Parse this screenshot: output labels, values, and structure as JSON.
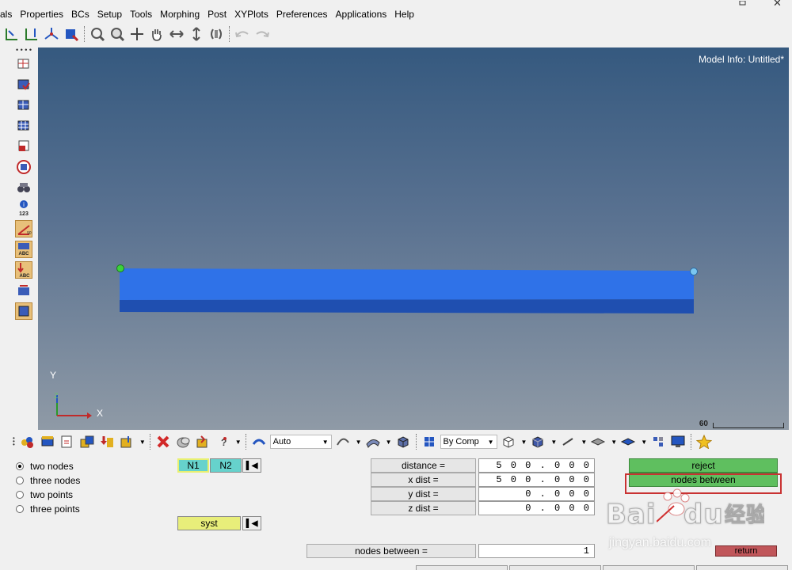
{
  "menu": [
    "als",
    "Properties",
    "BCs",
    "Setup",
    "Tools",
    "Morphing",
    "Post",
    "XYPlots",
    "Preferences",
    "Applications",
    "Help"
  ],
  "viewport": {
    "model_info": "Model Info: Untitled*",
    "axis_y": "Y",
    "axis_z": "Z",
    "axis_x": "X",
    "scale_label": "60"
  },
  "bottom_toolbar": {
    "auto_label": "Auto",
    "by_comp_label": "By Comp"
  },
  "panel": {
    "options": [
      {
        "label": "two nodes",
        "checked": true
      },
      {
        "label": "three nodes",
        "checked": false
      },
      {
        "label": "two points",
        "checked": false
      },
      {
        "label": "three points",
        "checked": false
      }
    ],
    "n1": "N1",
    "n2": "N2",
    "syst": "syst",
    "distance_label": "distance =",
    "distance_value": "500.000",
    "xdist_label": "x dist  =",
    "xdist_value": "500.000",
    "ydist_label": "y dist  =",
    "ydist_value": "0.000",
    "zdist_label": "z dist  =",
    "zdist_value": "0.000",
    "nodes_between_label": "nodes between  =",
    "nodes_between_value": "1",
    "reject": "reject",
    "nodes_between_btn": "nodes  between",
    "return": "return"
  },
  "watermark": {
    "brand": "Bai du 经验",
    "url": "jingyan.baidu.com"
  },
  "colors": {
    "beam_top": "#2f72e8",
    "beam_side": "#1f4fb0",
    "accent_green": "#5fbf5f",
    "accent_red": "#c0565a",
    "accent_cyan": "#66d2cc",
    "accent_yellow": "#e8ee7a"
  }
}
